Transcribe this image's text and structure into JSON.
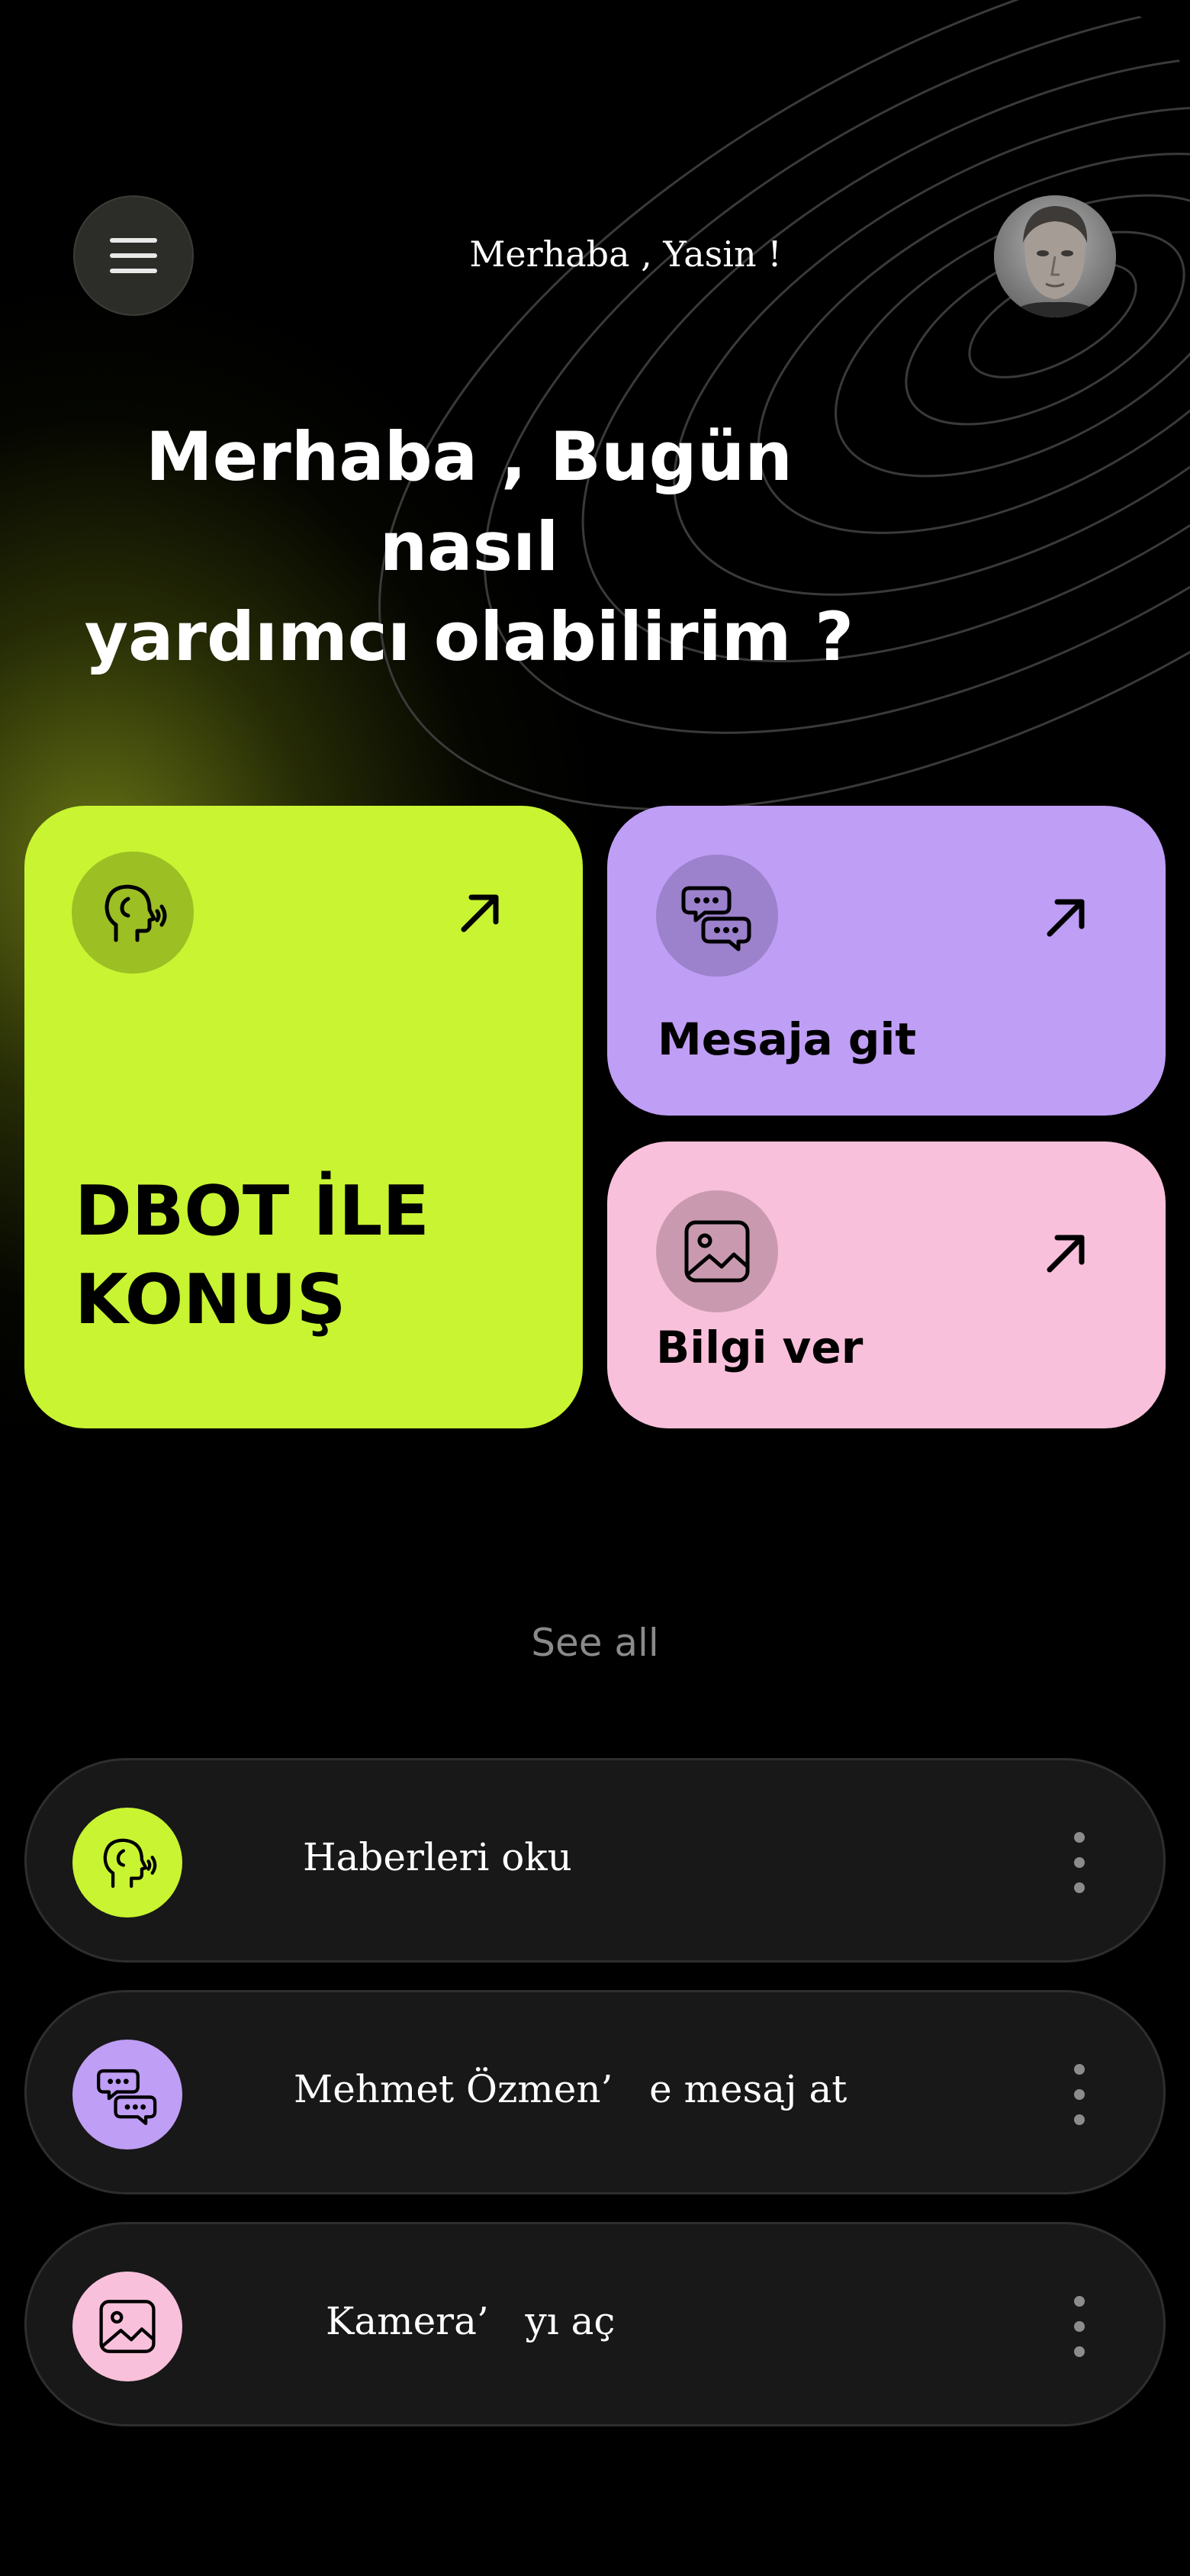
{
  "header": {
    "greeting": "Merhaba , Yasin !",
    "menu_icon": "hamburger-menu-icon",
    "avatar": "user-avatar"
  },
  "headline": {
    "line1": "Merhaba , Bugün nasıl",
    "line2": "yardımcı olabilirim ?"
  },
  "cards": {
    "main": {
      "line1": "DBOT İLE",
      "line2": "KONUŞ",
      "icon": "speaking-head-icon",
      "color": "#c8f432"
    },
    "message": {
      "label": "Mesaja git",
      "icon": "chat-bubbles-icon",
      "color": "#bf9ef5"
    },
    "info": {
      "label": "Bilgi ver",
      "icon": "image-icon",
      "color": "#f9c0db"
    }
  },
  "see_all": "See all",
  "list": [
    {
      "label": "Haberleri oku",
      "icon": "speaking-head-icon",
      "color": "#c8f432"
    },
    {
      "label": "Mehmet Özmen’   e mesaj at",
      "icon": "chat-bubbles-icon",
      "color": "#bf9ef5"
    },
    {
      "label": "Kamera’   yı aç",
      "icon": "image-icon",
      "color": "#f9c0db"
    }
  ]
}
